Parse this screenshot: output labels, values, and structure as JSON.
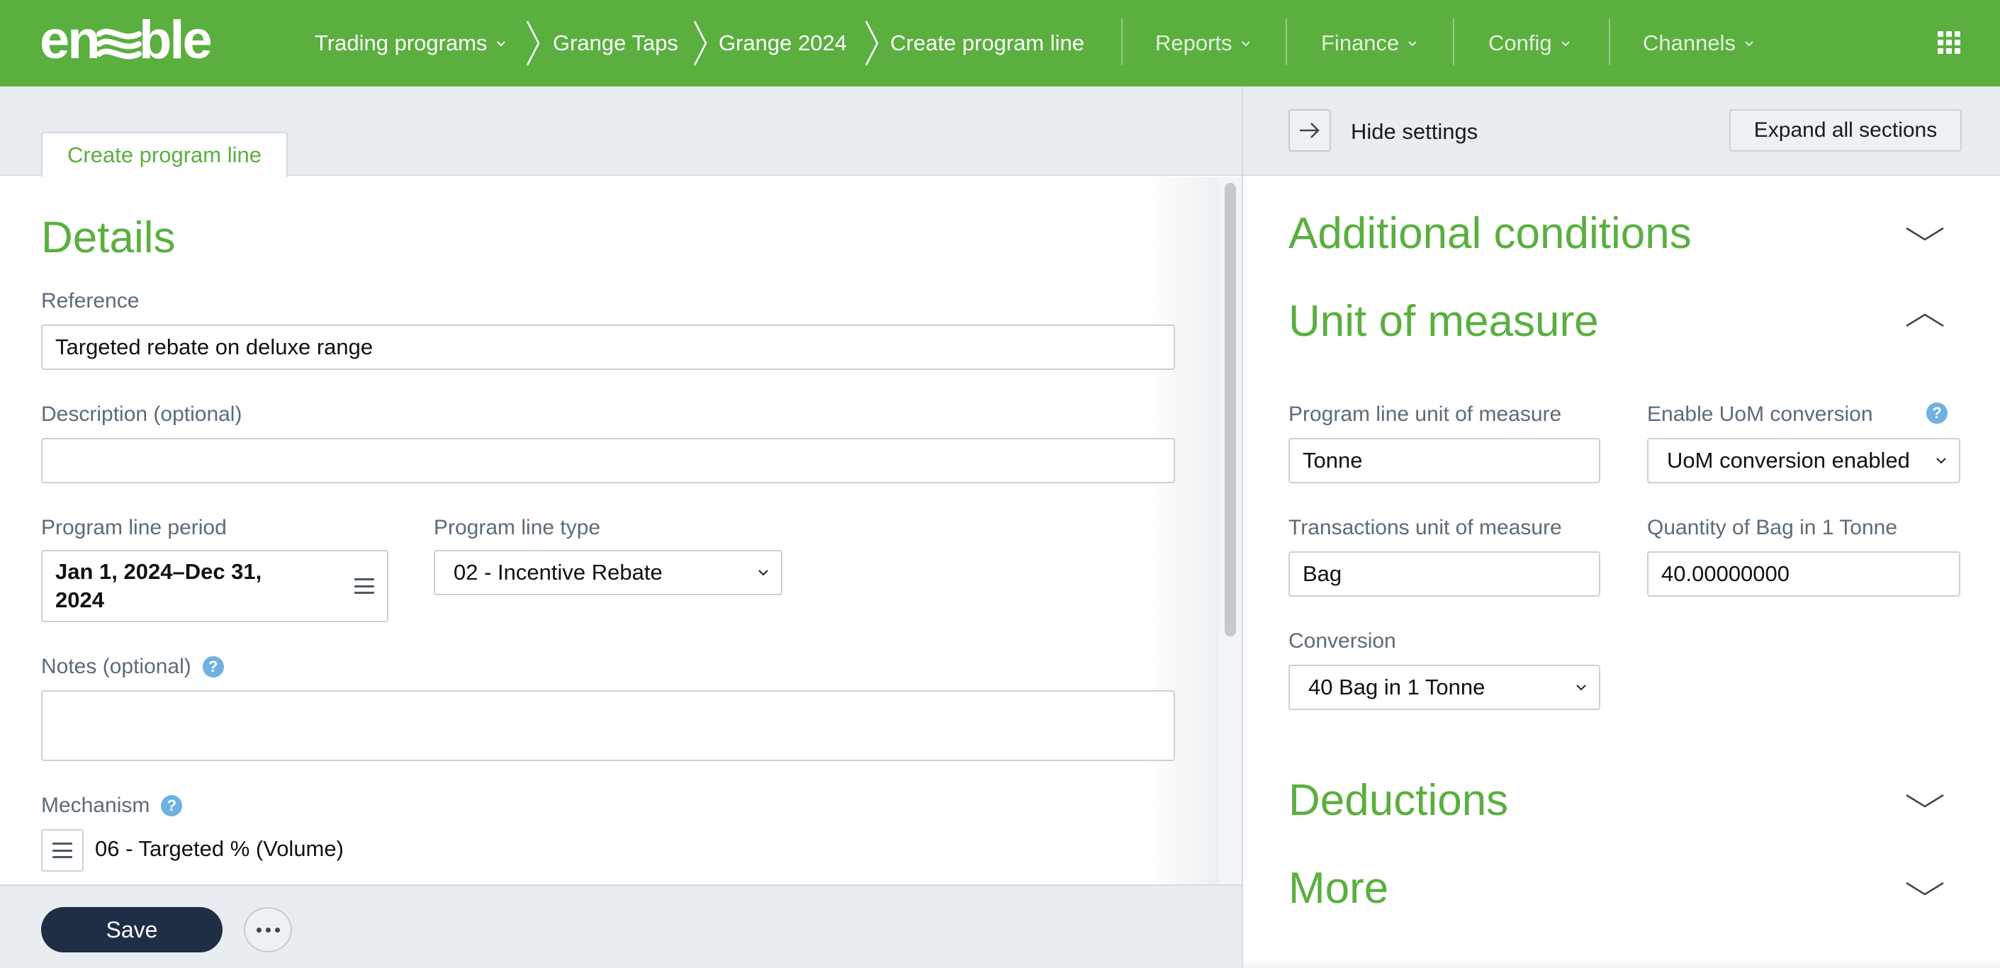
{
  "app": {
    "logo_text": "enable"
  },
  "topnav": {
    "breadcrumbs": [
      {
        "label": "Trading programs",
        "has_dropdown": true
      },
      {
        "label": "Grange Taps"
      },
      {
        "label": "Grange 2024"
      },
      {
        "label": "Create program line"
      }
    ],
    "menus": [
      {
        "label": "Reports"
      },
      {
        "label": "Finance"
      },
      {
        "label": "Config"
      },
      {
        "label": "Channels"
      }
    ],
    "apps_icon": "grid-icon"
  },
  "left": {
    "tab_label": "Create program line",
    "details_title": "Details",
    "reference": {
      "label": "Reference",
      "value": "Targeted rebate on deluxe range"
    },
    "description": {
      "label": "Description (optional)",
      "value": ""
    },
    "period": {
      "label": "Program line period",
      "value": "Jan 1, 2024–Dec 31, 2024"
    },
    "line_type": {
      "label": "Program line type",
      "value": "02 - Incentive Rebate"
    },
    "notes": {
      "label": "Notes (optional)",
      "value": ""
    },
    "mechanism": {
      "label": "Mechanism",
      "value": "06 - Targeted % (Volume)"
    }
  },
  "footer": {
    "save_label": "Save",
    "more_icon": "ellipsis-icon"
  },
  "right": {
    "hide_settings_label": "Hide settings",
    "expand_all_label": "Expand all sections",
    "sections": {
      "additional_conditions": "Additional conditions",
      "unit_of_measure": "Unit of measure",
      "deductions": "Deductions",
      "more": "More"
    },
    "uom": {
      "program_line_uom": {
        "label": "Program line unit of measure",
        "value": "Tonne"
      },
      "enable_conversion": {
        "label": "Enable UoM conversion",
        "value": "UoM conversion enabled"
      },
      "transactions_uom": {
        "label": "Transactions unit of measure",
        "value": "Bag"
      },
      "quantity": {
        "label": "Quantity of Bag in 1 Tonne",
        "value": "40.00000000"
      },
      "conversion": {
        "label": "Conversion",
        "value": "40 Bag in 1 Tonne"
      }
    }
  },
  "help_glyph": "?",
  "colors": {
    "brand_green": "#5aaf3f",
    "primary_dark": "#1f2d45",
    "help_blue": "#6fb1e0"
  }
}
